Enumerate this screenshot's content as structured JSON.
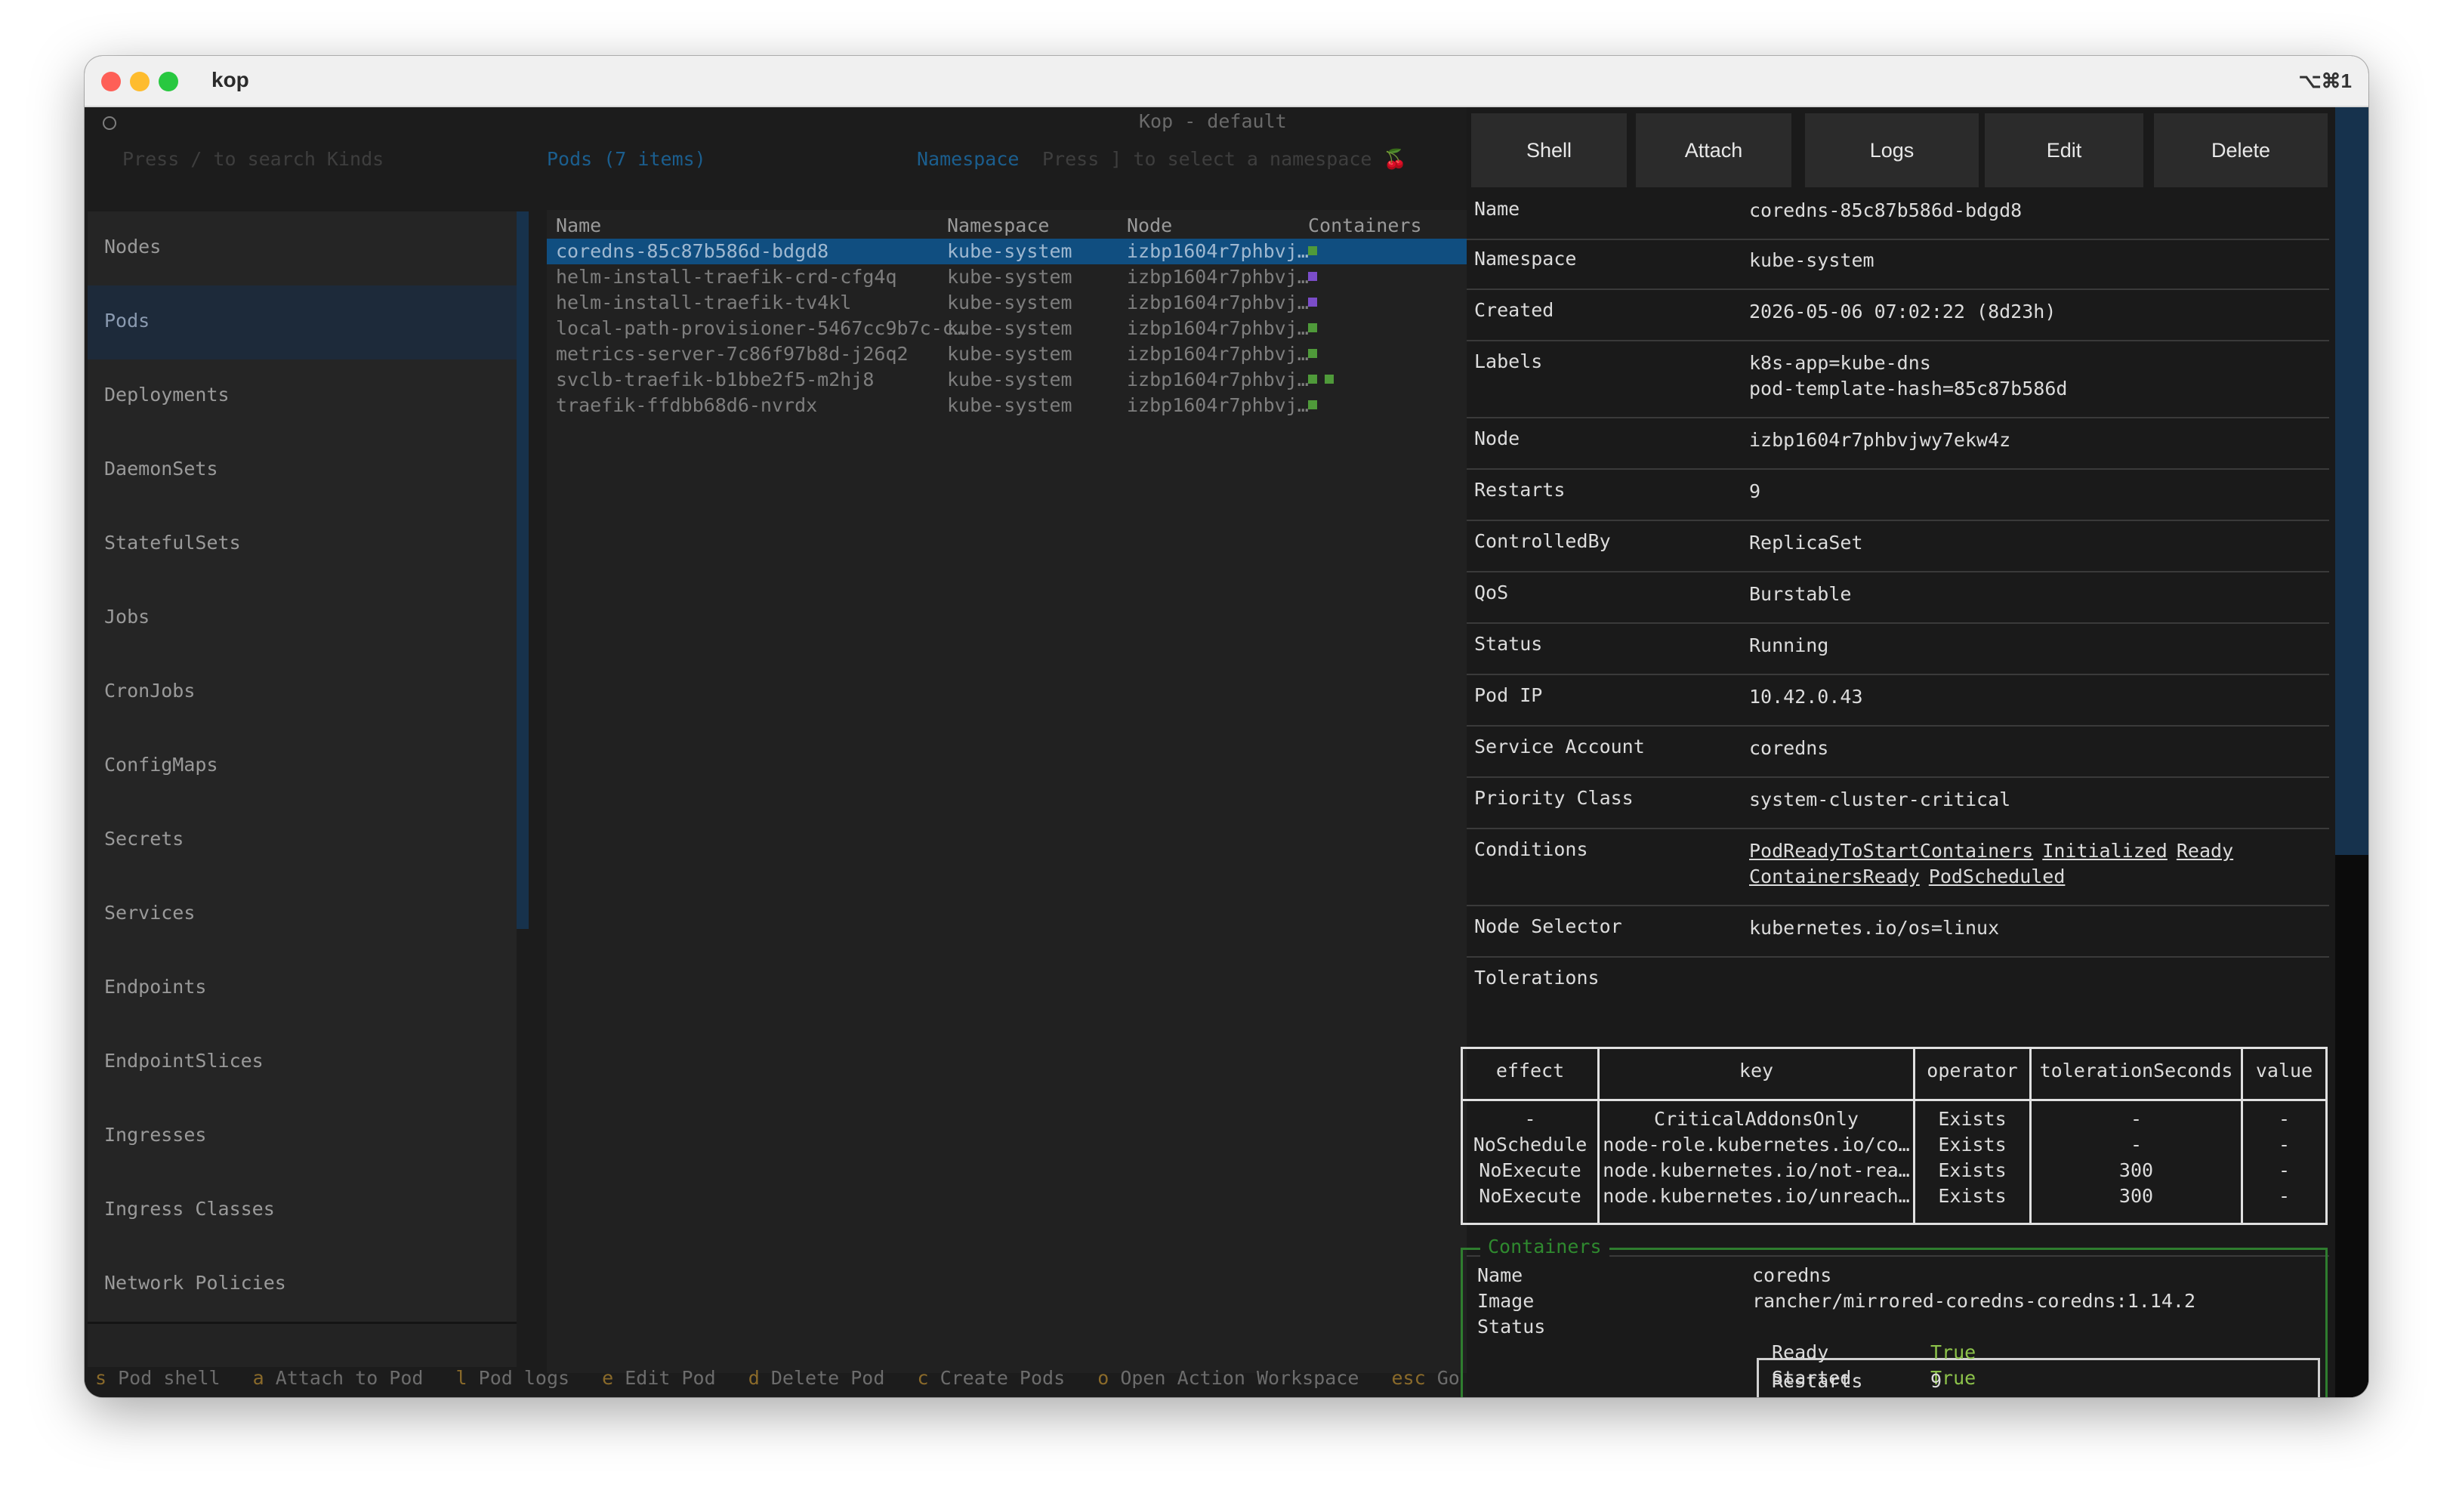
{
  "window": {
    "title": "kop",
    "shortcut": "⌥⌘1"
  },
  "app_title": "Kop - default",
  "search": {
    "placeholder": "Press / to search Kinds"
  },
  "pods_header": "Pods (7 items)",
  "namespace": {
    "label": "Namespace",
    "placeholder": "Press ] to select a namespace 🍒"
  },
  "kinds": [
    "Nodes",
    "Pods",
    "Deployments",
    "DaemonSets",
    "StatefulSets",
    "Jobs",
    "CronJobs",
    "ConfigMaps",
    "Secrets",
    "Services",
    "Endpoints",
    "EndpointSlices",
    "Ingresses",
    "Ingress Classes",
    "Network Policies"
  ],
  "columns": [
    "Name",
    "Namespace",
    "Node",
    "Containers"
  ],
  "pods": [
    {
      "name": "coredns-85c87b586d-bdgd8",
      "namespace": "kube-system",
      "node": "izbp1604r7phbvj…",
      "containers": "green"
    },
    {
      "name": "helm-install-traefik-crd-cfg4q",
      "namespace": "kube-system",
      "node": "izbp1604r7phbvj…",
      "containers": "purple"
    },
    {
      "name": "helm-install-traefik-tv4kl",
      "namespace": "kube-system",
      "node": "izbp1604r7phbvj…",
      "containers": "purple"
    },
    {
      "name": "local-path-provisioner-5467cc9b7c-c…",
      "namespace": "kube-system",
      "node": "izbp1604r7phbvj…",
      "containers": "green"
    },
    {
      "name": "metrics-server-7c86f97b8d-j26q2",
      "namespace": "kube-system",
      "node": "izbp1604r7phbvj…",
      "containers": "green"
    },
    {
      "name": "svclb-traefik-b1bbe2f5-m2hj8",
      "namespace": "kube-system",
      "node": "izbp1604r7phbvj…",
      "containers": "green2"
    },
    {
      "name": "traefik-ffdbb68d6-nvrdx",
      "namespace": "kube-system",
      "node": "izbp1604r7phbvj…",
      "containers": "green"
    }
  ],
  "statusbar": [
    {
      "key": "s",
      "desc": "Pod shell"
    },
    {
      "key": "a",
      "desc": "Attach to Pod"
    },
    {
      "key": "l",
      "desc": "Pod logs"
    },
    {
      "key": "e",
      "desc": "Edit Pod"
    },
    {
      "key": "d",
      "desc": "Delete Pod"
    },
    {
      "key": "c",
      "desc": "Create Pods"
    },
    {
      "key": "o",
      "desc": "Open Action Workspace"
    },
    {
      "key": "esc",
      "desc": "Go back startup"
    }
  ],
  "actions": [
    "Shell",
    "Attach",
    "Logs",
    "Edit",
    "Delete"
  ],
  "details": {
    "name": {
      "k": "Name",
      "v": "coredns-85c87b586d-bdgd8"
    },
    "namespace": {
      "k": "Namespace",
      "v": "kube-system"
    },
    "created": {
      "k": "Created",
      "v": "2026-05-06 07:02:22 (8d23h)"
    },
    "labels": {
      "k": "Labels",
      "v1": "k8s-app=kube-dns",
      "v2": "pod-template-hash=85c87b586d"
    },
    "node": {
      "k": "Node",
      "v": "izbp1604r7phbvjwy7ekw4z"
    },
    "restarts": {
      "k": "Restarts",
      "v": "9"
    },
    "controlled_by": {
      "k": "ControlledBy",
      "v": "ReplicaSet"
    },
    "qos": {
      "k": "QoS",
      "v": "Burstable"
    },
    "status": {
      "k": "Status",
      "v": "Running"
    },
    "pod_ip": {
      "k": "Pod IP",
      "v": "10.42.0.43"
    },
    "service_account": {
      "k": "Service Account",
      "v": "coredns"
    },
    "priority_class": {
      "k": "Priority Class",
      "v": "system-cluster-critical"
    },
    "conditions": {
      "k": "Conditions",
      "items": [
        "PodReadyToStartContainers",
        "Initialized",
        "Ready",
        "ContainersReady",
        "PodScheduled"
      ]
    },
    "node_selector": {
      "k": "Node Selector",
      "v": "kubernetes.io/os=linux"
    },
    "tolerations_label": "Tolerations"
  },
  "tolerations": {
    "headers": [
      "effect",
      "key",
      "operator",
      "tolerationSeconds",
      "value"
    ],
    "rows": [
      [
        "-",
        "CriticalAddonsOnly",
        "Exists",
        "-",
        "-"
      ],
      [
        "NoSchedule",
        "node-role.kubernetes.io/co…",
        "Exists",
        "-",
        "-"
      ],
      [
        "NoExecute",
        "node.kubernetes.io/not-rea…",
        "Exists",
        "300",
        "-"
      ],
      [
        "NoExecute",
        "node.kubernetes.io/unreach…",
        "Exists",
        "300",
        "-"
      ]
    ]
  },
  "containers": {
    "title": "Containers",
    "name_k": "Name",
    "name_v": "coredns",
    "image_k": "Image",
    "image_v": "rancher/mirrored-coredns-coredns:1.14.2",
    "status_k": "Status",
    "status": [
      {
        "k": "Ready",
        "v": "True"
      },
      {
        "k": "Started",
        "v": "True"
      },
      {
        "k": "Restarts",
        "v": "9"
      }
    ]
  },
  "colors": {
    "selected_row": "#104e80",
    "accent_blue": "#1b5e8e",
    "container_green": "#4f9a3a",
    "container_purple": "#7b4dc9",
    "true_green": "#8cc24a"
  }
}
